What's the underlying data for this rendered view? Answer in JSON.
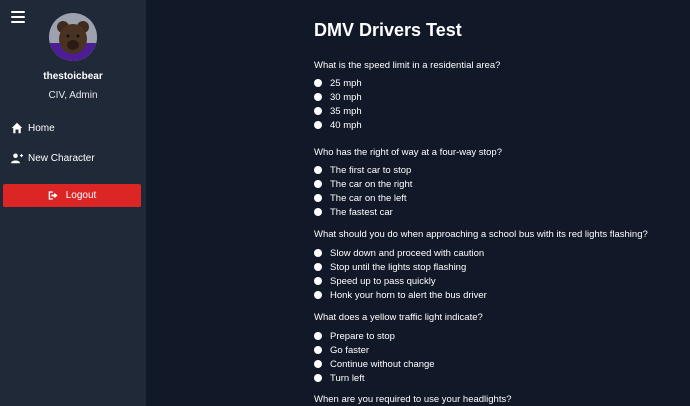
{
  "sidebar": {
    "username": "thestoicbear",
    "role": "CIV, Admin",
    "nav": [
      {
        "label": "Home",
        "icon": "home-icon"
      },
      {
        "label": "New Character",
        "icon": "user-plus-icon"
      }
    ],
    "logout_label": "Logout"
  },
  "main": {
    "title": "DMV Drivers Test",
    "questions": [
      {
        "text": "What is the speed limit in a residential area?",
        "options": [
          "25 mph",
          "30 mph",
          "35 mph",
          "40 mph"
        ]
      },
      {
        "text": "Who has the right of way at a four-way stop?",
        "options": [
          "The first car to stop",
          "The car on the right",
          "The car on the left",
          "The fastest car"
        ]
      },
      {
        "text": "What should you do when approaching a school bus with its red lights flashing?",
        "options": [
          "Slow down and proceed with caution",
          "Stop until the lights stop flashing",
          "Speed up to pass quickly",
          "Honk your horn to alert the bus driver"
        ]
      },
      {
        "text": "What does a yellow traffic light indicate?",
        "options": [
          "Prepare to stop",
          "Go faster",
          "Continue without change",
          "Turn left"
        ]
      },
      {
        "text": "When are you required to use your headlights?",
        "options": []
      }
    ]
  },
  "colors": {
    "sidebar_bg": "#1f2937",
    "main_bg": "#111827",
    "logout_bg": "#dc2626"
  }
}
